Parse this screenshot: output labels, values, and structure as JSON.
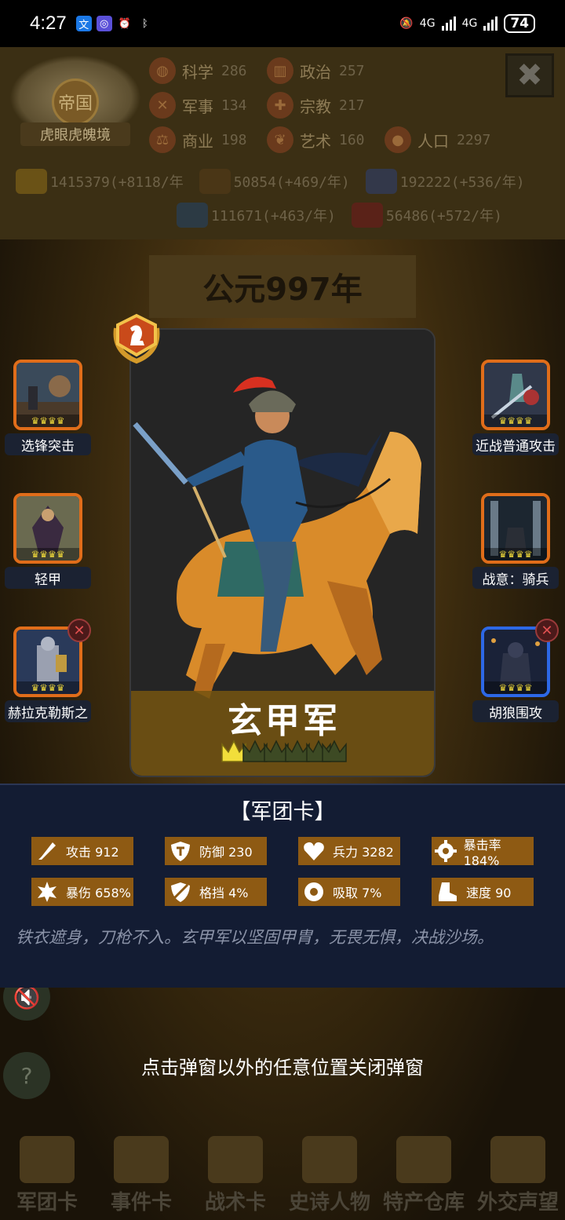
{
  "status_bar": {
    "time": "4:27",
    "network_1": "4G",
    "network_2": "4G",
    "battery": "74"
  },
  "header": {
    "realm_emblem": "帝国",
    "realm_status": "虎眼虎魄境",
    "close_icon": "close-icon",
    "stats": [
      {
        "label": "科学",
        "value": "286",
        "icon": "planet-icon"
      },
      {
        "label": "政治",
        "value": "257",
        "icon": "capitol-icon"
      },
      {
        "label": "军事",
        "value": "134",
        "icon": "crossed-swords-icon"
      },
      {
        "label": "宗教",
        "value": "217",
        "icon": "cross-icon"
      },
      {
        "label": "商业",
        "value": "198",
        "icon": "scales-icon"
      },
      {
        "label": "艺术",
        "value": "160",
        "icon": "lotus-icon"
      },
      {
        "label": "人口",
        "value": "2297",
        "icon": "person-icon"
      }
    ],
    "resources": [
      {
        "value": "1415379(+8118/年",
        "icon": "gold-icon"
      },
      {
        "value": "50854(+469/年)",
        "icon": "wood-icon"
      },
      {
        "value": "192222(+536/年)",
        "icon": "feather-icon"
      },
      {
        "value": "111671(+463/年)",
        "icon": "ore-icon"
      },
      {
        "value": "56486(+572/年)",
        "icon": "meat-icon"
      }
    ]
  },
  "year": "公元997年",
  "skills_left": [
    {
      "label": "选锋突击",
      "removable": false
    },
    {
      "label": "轻甲",
      "removable": false
    },
    {
      "label": "赫拉克勒斯之",
      "removable": true
    }
  ],
  "skills_right": [
    {
      "label": "近战普通攻击",
      "removable": false
    },
    {
      "label": "战意：骑兵",
      "removable": false
    },
    {
      "label": "胡狼围攻",
      "removable": true
    }
  ],
  "card": {
    "name": "玄甲军",
    "stars_total": 6,
    "stars_filled": 1,
    "rank_icon": "knight-chess-icon"
  },
  "info": {
    "title": "【军团卡】",
    "attributes": [
      {
        "label": "攻击 912",
        "icon": "sword-icon"
      },
      {
        "label": "防御 230",
        "icon": "shield-icon"
      },
      {
        "label": "兵力 3282",
        "icon": "heart-icon"
      },
      {
        "label": "暴击率 184%",
        "icon": "crit-icon"
      },
      {
        "label": "暴伤 658%",
        "icon": "burst-icon"
      },
      {
        "label": "格挡 4%",
        "icon": "block-icon"
      },
      {
        "label": "吸取 7%",
        "icon": "drain-icon"
      },
      {
        "label": "速度 90",
        "icon": "boot-icon"
      }
    ],
    "description": "铁衣遮身，刀枪不入。玄甲军以坚固甲胄，无畏无惧，决战沙场。"
  },
  "hint": "点击弹窗以外的任意位置关闭弹窗",
  "bottom_tabs": [
    {
      "label": "军团卡"
    },
    {
      "label": "事件卡"
    },
    {
      "label": "战术卡"
    },
    {
      "label": "史诗人物"
    },
    {
      "label": "特产仓库"
    },
    {
      "label": "外交声望"
    }
  ],
  "colors": {
    "slot_orange": "#e06d1a",
    "slot_blue": "#2d68e6",
    "attr_bg": "#8e5a13",
    "panel_bg": "#131c33",
    "crown_gold": "#e8d23a"
  }
}
